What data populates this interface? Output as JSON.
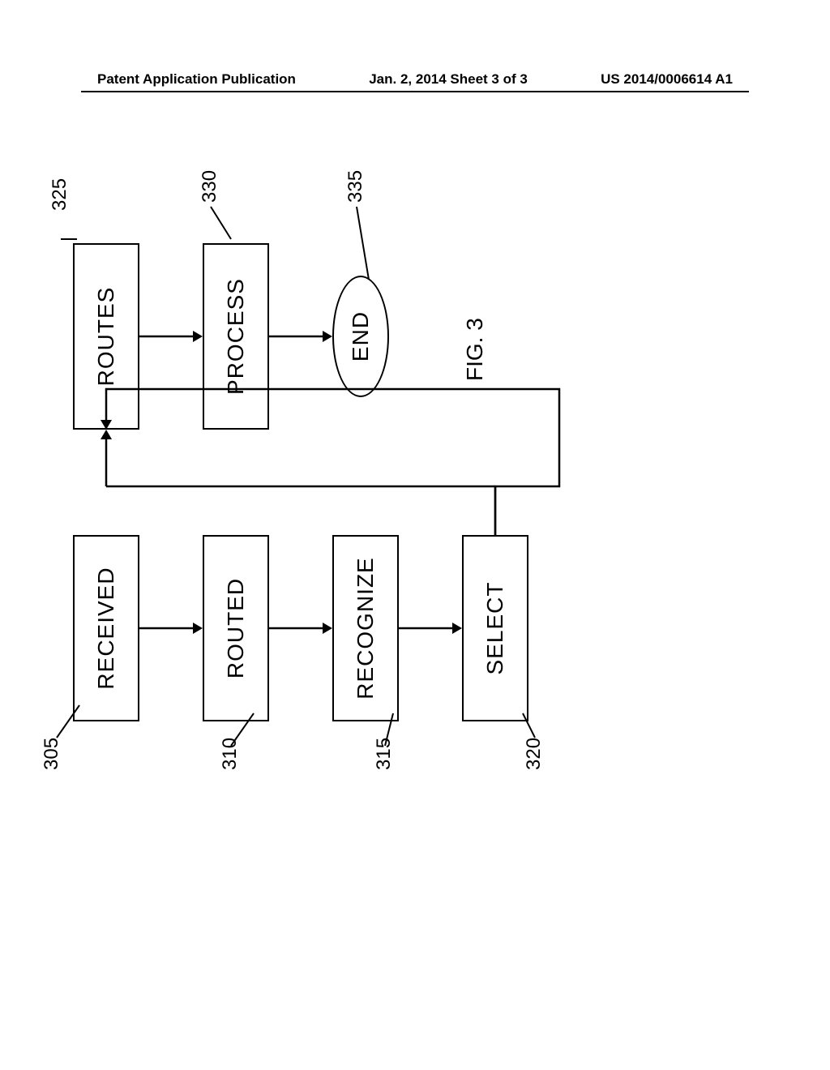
{
  "header": {
    "left": "Patent Application Publication",
    "center": "Jan. 2, 2014   Sheet 3 of 3",
    "right": "US 2014/0006614 A1"
  },
  "blocks": {
    "b305": "RECEIVED",
    "b310": "ROUTED",
    "b315": "RECOGNIZE",
    "b320": "SELECT",
    "b325": "ROUTES",
    "b330": "PROCESS",
    "b335": "END"
  },
  "refs": {
    "r305": "305",
    "r310": "310",
    "r315": "315",
    "r320": "320",
    "r325": "325",
    "r330": "330",
    "r335": "335"
  },
  "figure_label": "FIG. 3"
}
